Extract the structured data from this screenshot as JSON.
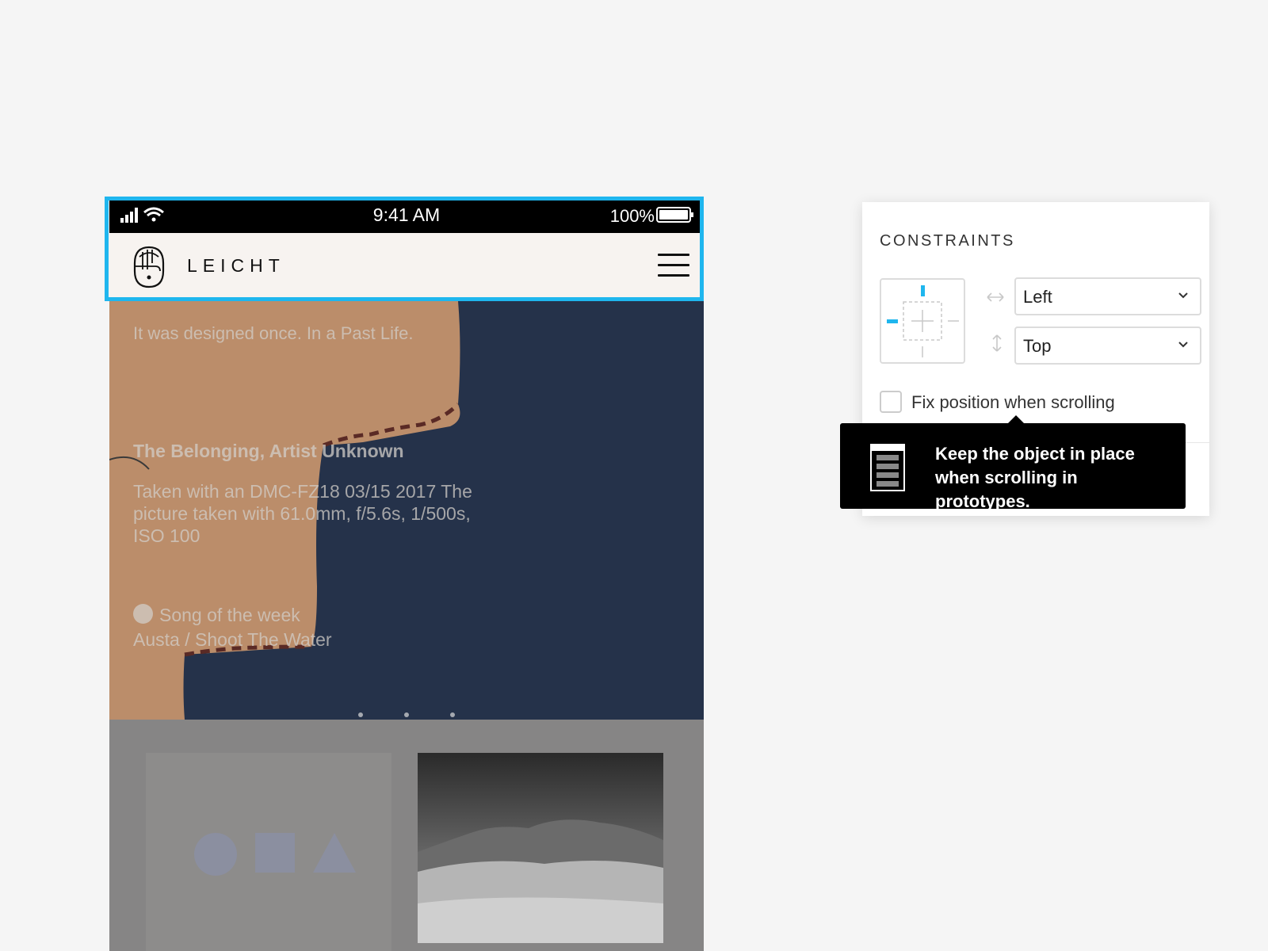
{
  "status_bar": {
    "time": "9:41 AM",
    "battery_percent": "100%"
  },
  "nav": {
    "brand": "LEICHT"
  },
  "hero": {
    "tagline": "It was designed once. In a Past Life.",
    "photo_title": "The Belonging, Artist Unknown",
    "photo_meta": "Taken with an DMC-FZ18 03/15 2017 The picture taken with 61.0mm, f/5.6s, 1/500s, ISO 100",
    "song_label": "Song of the week",
    "song_track": "Austa / Shoot The Water",
    "page_dots": 3
  },
  "constraints_panel": {
    "title": "CONSTRAINTS",
    "horizontal": "Left",
    "vertical": "Top",
    "fix_position_label": "Fix position when scrolling",
    "fix_position_checked": false
  },
  "tooltip": {
    "text": "Keep the object in place when scrolling in prototypes."
  },
  "colors": {
    "selection": "#1fb6ee",
    "hero_bg": "#25324a",
    "fabric": "#c8956c"
  }
}
